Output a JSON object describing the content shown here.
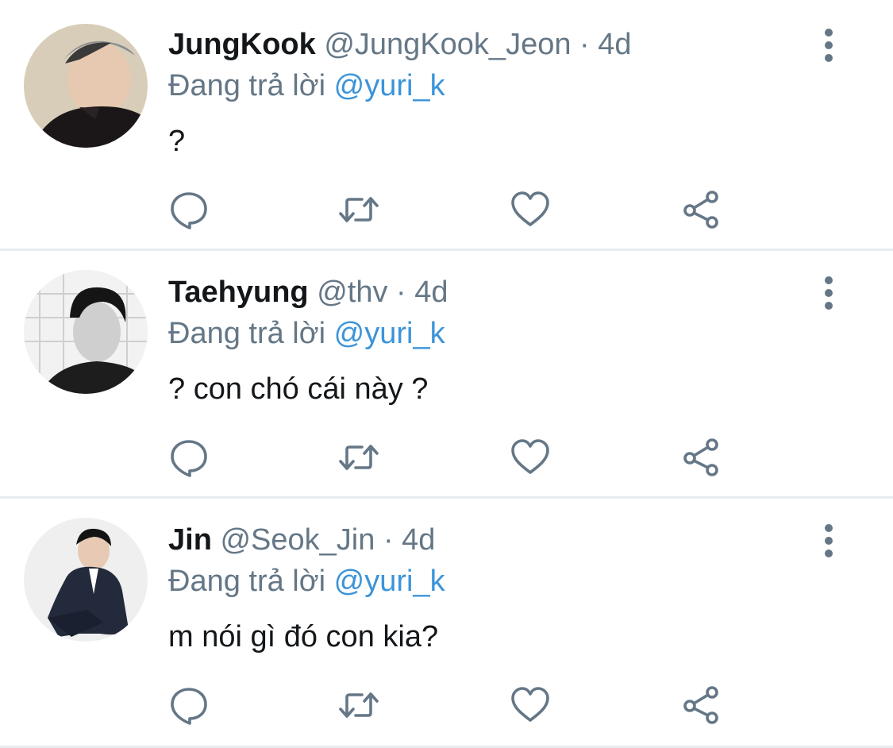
{
  "tweets": [
    {
      "display_name": "JungKook",
      "handle": "@JungKook_Jeon",
      "separator": "·",
      "time": "4d",
      "reply_prefix": "Đang trả lời",
      "reply_to": "@yuri_k",
      "text": "?",
      "avatar": "avatar-photo"
    },
    {
      "display_name": "Taehyung",
      "handle": "@thv",
      "separator": "·",
      "time": "4d",
      "reply_prefix": "Đang trả lời",
      "reply_to": "@yuri_k",
      "text": "? con chó cái này ?",
      "avatar": "avatar-photo"
    },
    {
      "display_name": "Jin",
      "handle": "@Seok_Jin",
      "separator": "·",
      "time": "4d",
      "reply_prefix": "Đang trả lời",
      "reply_to": "@yuri_k",
      "text": "m nói gì đó con kia?",
      "avatar": "avatar-photo"
    }
  ],
  "actions": {
    "reply": "reply-icon",
    "retweet": "retweet-icon",
    "like": "heart-icon",
    "share": "share-icon",
    "more": "more-vertical-icon"
  },
  "colors": {
    "text": "#14171a",
    "muted": "#657786",
    "link": "#3b94d9",
    "divider": "#e6ecf0"
  }
}
